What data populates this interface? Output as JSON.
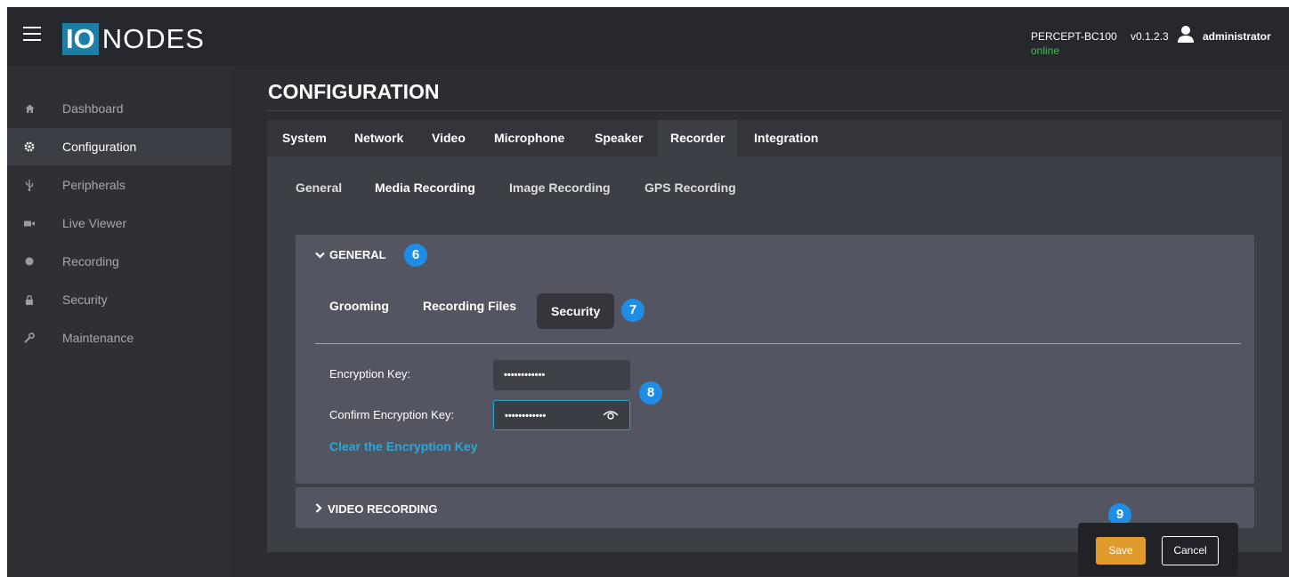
{
  "header": {
    "logo_box": "IO",
    "logo_text": "NODES",
    "device_name": "PERCEPT-BC100",
    "device_status": "online",
    "version": "v0.1.2.3",
    "username": "administrator"
  },
  "sidebar": {
    "items": [
      {
        "label": "Dashboard",
        "icon": "home-icon"
      },
      {
        "label": "Configuration",
        "icon": "gear-icon",
        "active": true
      },
      {
        "label": "Peripherals",
        "icon": "usb-icon"
      },
      {
        "label": "Live Viewer",
        "icon": "video-camera-icon"
      },
      {
        "label": "Recording",
        "icon": "record-icon"
      },
      {
        "label": "Security",
        "icon": "lock-icon"
      },
      {
        "label": "Maintenance",
        "icon": "wrench-icon"
      }
    ]
  },
  "main": {
    "title": "CONFIGURATION",
    "tabs": [
      "System",
      "Network",
      "Video",
      "Microphone",
      "Speaker",
      "Recorder",
      "Integration"
    ],
    "active_tab": "Recorder",
    "subtabs": [
      "General",
      "Media Recording",
      "Image Recording",
      "GPS Recording"
    ],
    "active_subtab": "Media Recording",
    "general_section": {
      "heading": "GENERAL",
      "badge": "6",
      "inner_tabs": [
        "Grooming",
        "Recording Files",
        "Security"
      ],
      "active_inner_tab": "Security",
      "inner_badge": "7",
      "encryption_key_label": "Encryption Key:",
      "encryption_key_value": "••••••••••••",
      "confirm_key_label": "Confirm Encryption Key:",
      "confirm_key_value": "••••••••••••",
      "fields_badge": "8",
      "clear_link": "Clear the Encryption Key"
    },
    "video_section": {
      "heading": "VIDEO RECORDING"
    }
  },
  "actions": {
    "badge": "9",
    "save_label": "Save",
    "cancel_label": "Cancel"
  },
  "colors": {
    "accent_blue": "#1f8ce6",
    "link": "#2aa8db",
    "save": "#e19b2c",
    "online": "#3ec14d"
  }
}
